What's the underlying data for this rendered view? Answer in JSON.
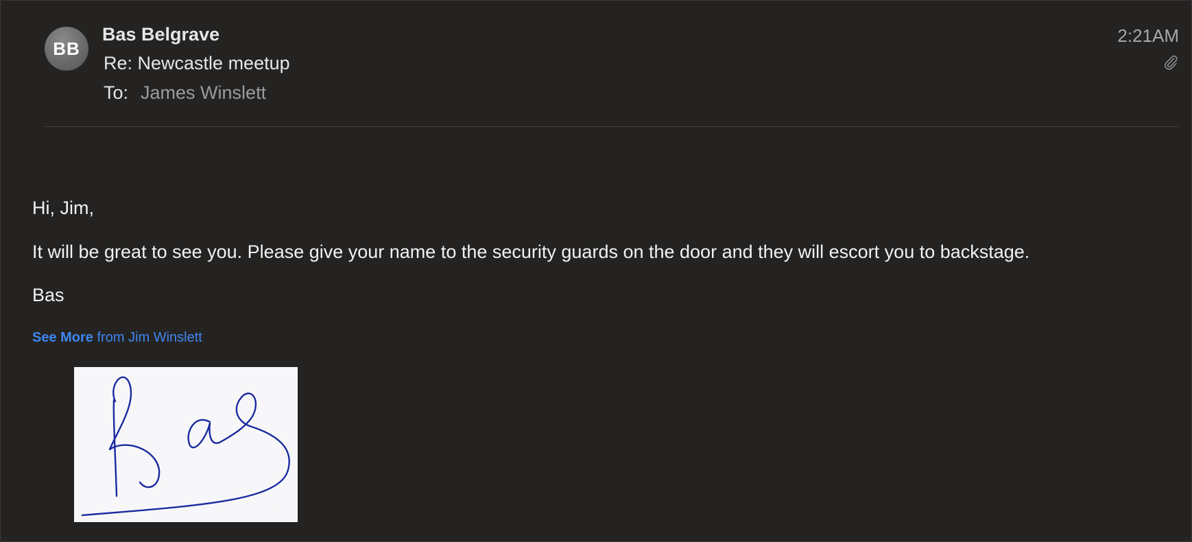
{
  "message": {
    "avatar_initials": "BB",
    "sender_name": "Bas Belgrave",
    "subject": "Re: Newcastle meetup",
    "to_label": "To:",
    "to_name": "James Winslett",
    "time": "2:21AM",
    "has_attachment": true,
    "attachment_icon": "paperclip-icon"
  },
  "body": {
    "greeting": "Hi, Jim,",
    "paragraph": "It will be great to see you. Please give your name to the security guards on the door and they will escort you to backstage.",
    "signoff": "Bas",
    "see_more_bold": "See More",
    "see_more_rest": " from Jim Winslett"
  },
  "signature_image": {
    "text": "Bas",
    "ink_color": "#1a2aa0"
  },
  "colors": {
    "background": "#242322",
    "link": "#3f86f0"
  }
}
